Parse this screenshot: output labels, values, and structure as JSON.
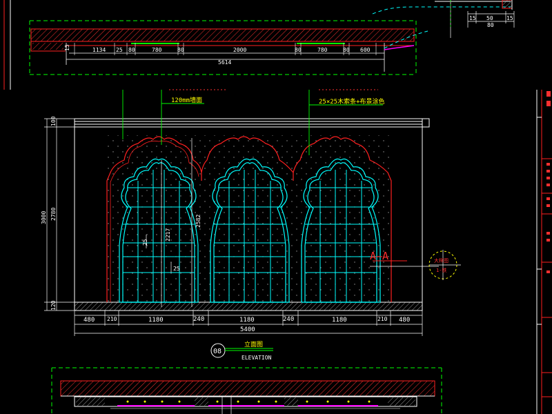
{
  "colors": {
    "background": "#000000",
    "red": "#ff2020",
    "cyan": "#00ffff",
    "green": "#00ff00",
    "yellow": "#ffff00",
    "white": "#ffffff",
    "magenta": "#ff00ff"
  },
  "top_plan": {
    "dims_small": [
      "15",
      "1134",
      "25",
      "80",
      "780",
      "80",
      "2000",
      "80",
      "780",
      "80",
      "600"
    ],
    "total": "5614"
  },
  "top_right_dims": [
    "15",
    "50",
    "15",
    "80"
  ],
  "annotations": {
    "note_1": "120mm墙面",
    "note_2": "25×25木索条+布景涂色",
    "dim_2217": "2217",
    "dim_2582": "2582",
    "dim_25a": "25",
    "dim_25b": "25"
  },
  "left_dims": {
    "d100": "100",
    "d3000": "3000",
    "d2780": "2780",
    "d120": "120"
  },
  "bottom_dims": [
    "480",
    "210",
    "1180",
    "240",
    "1180",
    "240",
    "1180",
    "210",
    "480"
  ],
  "bottom_total": "5400",
  "section_mark": {
    "label": "A—A"
  },
  "callout": {
    "top": "大样图",
    "bottom": "1-铁"
  },
  "title_block": {
    "number": "08",
    "title": "立面图",
    "subtitle": "ELEVATION"
  }
}
